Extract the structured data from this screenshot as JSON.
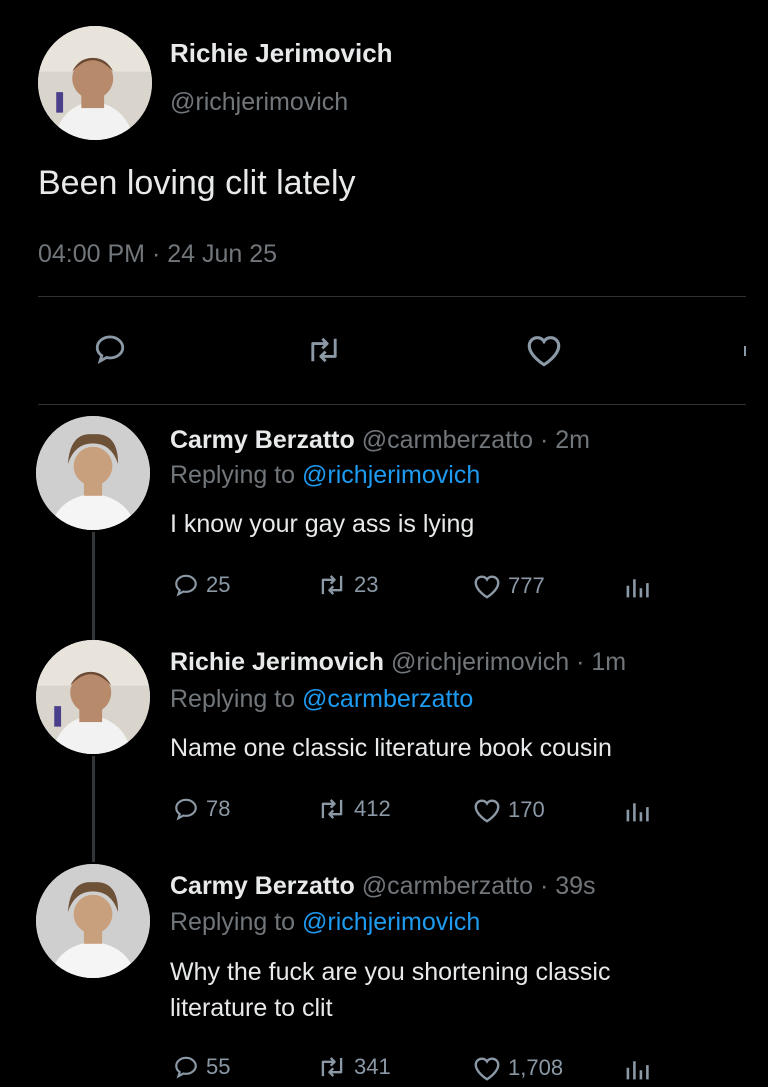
{
  "main_tweet": {
    "name": "Richie Jerimovich",
    "handle": "@richjerimovich",
    "text": "Been loving clit lately",
    "timestamp": "04:00 PM · 24 Jun 25"
  },
  "replies": [
    {
      "name": "Carmy Berzatto",
      "meta": "@carmberzatto · 2m",
      "replying_prefix": "Replying to",
      "replying_to": "@richjerimovich",
      "text": "I know your gay ass is lying",
      "stats": {
        "replies": "25",
        "retweets": "23",
        "likes": "777"
      }
    },
    {
      "name": "Richie Jerimovich",
      "meta": "@richjerimovich · 1m",
      "replying_prefix": "Replying to",
      "replying_to": "@carmberzatto",
      "text": "Name one classic literature book cousin",
      "stats": {
        "replies": "78",
        "retweets": "412",
        "likes": "170"
      }
    },
    {
      "name": "Carmy Berzatto",
      "meta": "@carmberzatto · 39s",
      "replying_prefix": "Replying to",
      "replying_to": "@richjerimovich",
      "text_line1": "Why the fuck are you shortening classic",
      "text_line2": "literature to clit",
      "stats": {
        "replies": "55",
        "retweets": "341",
        "likes": "1,708"
      }
    }
  ],
  "icons": [
    "reply-icon",
    "retweet-icon",
    "like-icon",
    "analytics-icon"
  ],
  "colors": {
    "background": "#000000",
    "text": "#e7e9ea",
    "muted": "#71767b",
    "link": "#1d9bf0"
  }
}
